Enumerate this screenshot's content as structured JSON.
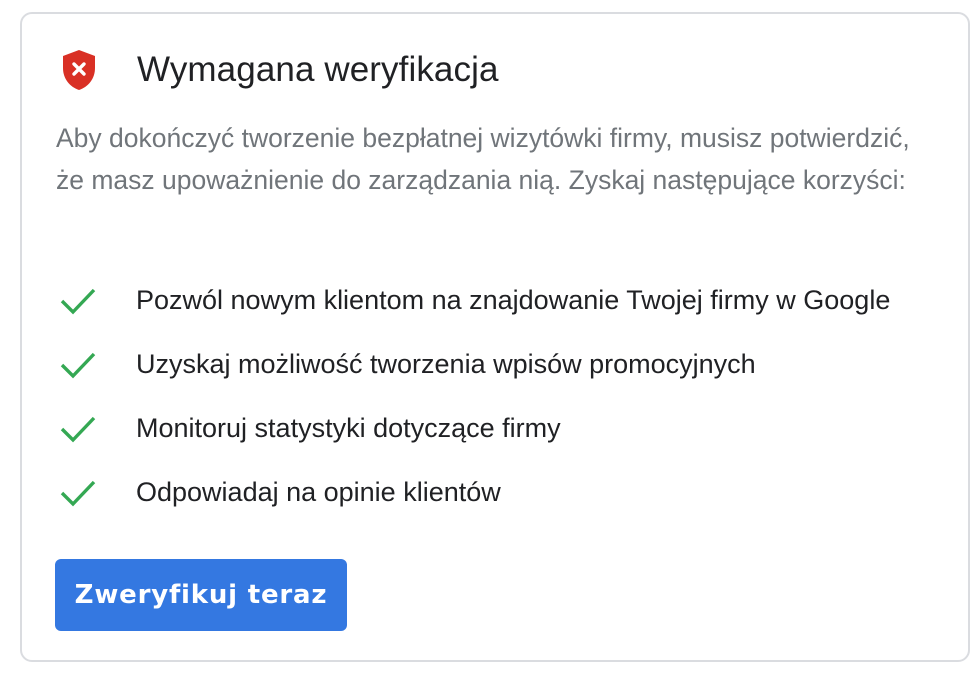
{
  "card": {
    "icon": "shield-error-icon",
    "title": "Wymagana weryfikacja",
    "description": "Aby dokończyć tworzenie bezpłatnej wizytówki firmy, musisz potwierdzić, że masz upoważnienie do zarządzania nią. Zyskaj następujące korzyści:",
    "benefits": [
      {
        "icon": "check-icon",
        "label": "Pozwól nowym klientom na znajdowanie Twojej firmy w Google"
      },
      {
        "icon": "check-icon",
        "label": "Uzyskaj możliwość tworzenia wpisów promocyjnych"
      },
      {
        "icon": "check-icon",
        "label": "Monitoruj statystyki dotyczące firmy"
      },
      {
        "icon": "check-icon",
        "label": "Odpowiadaj na opinie klientów"
      }
    ],
    "button_label": "Zweryfikuj teraz"
  },
  "colors": {
    "shield": "#d93025",
    "check": "#34a853",
    "button": "#3478e1",
    "title": "#202124",
    "description": "#70757a",
    "border": "#dadce0"
  }
}
